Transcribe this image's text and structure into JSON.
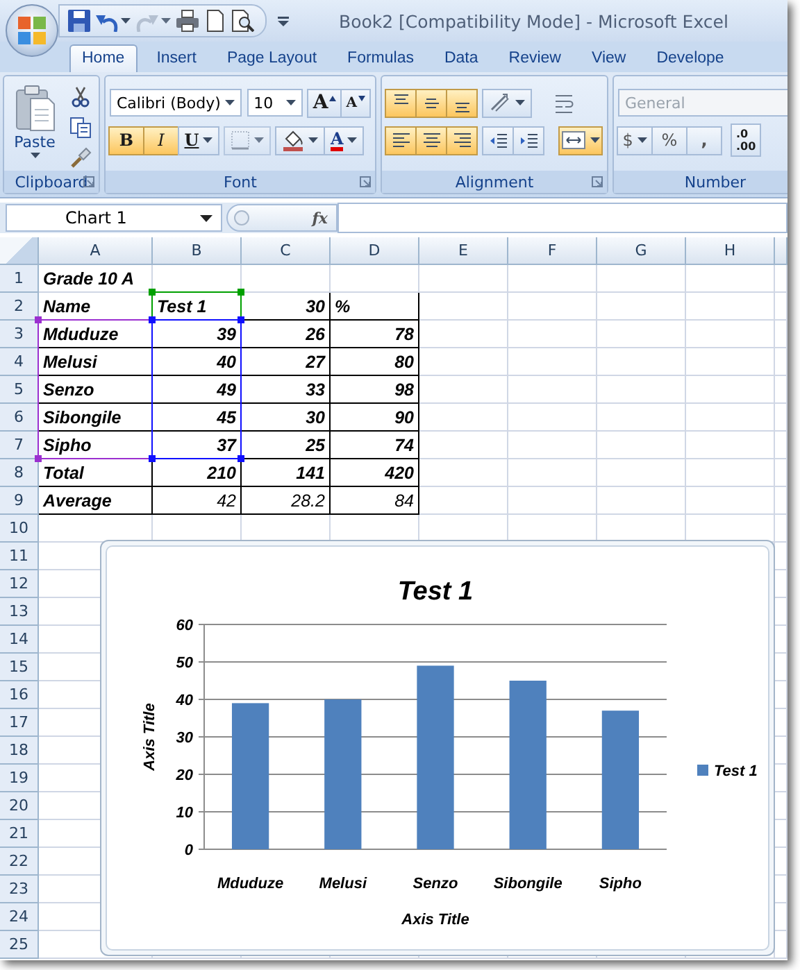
{
  "window": {
    "title": "Book2  [Compatibility Mode] - Microsoft Excel"
  },
  "tabs": [
    {
      "label": "Home",
      "selected": true
    },
    {
      "label": "Insert",
      "selected": false
    },
    {
      "label": "Page Layout",
      "selected": false
    },
    {
      "label": "Formulas",
      "selected": false
    },
    {
      "label": "Data",
      "selected": false
    },
    {
      "label": "Review",
      "selected": false
    },
    {
      "label": "View",
      "selected": false
    },
    {
      "label": "Develope",
      "selected": false
    }
  ],
  "ribbon": {
    "clipboard": {
      "label": "Clipboard",
      "paste": "Paste"
    },
    "font": {
      "label": "Font",
      "font_name": "Calibri (Body)",
      "font_size": "10",
      "grow": "A",
      "shrink": "A",
      "toggles": [
        {
          "label": "B",
          "on": true
        },
        {
          "label": "I",
          "on": true
        },
        {
          "label": "U",
          "on": false
        }
      ],
      "font_color": "A"
    },
    "alignment": {
      "label": "Alignment",
      "buttons": [
        {
          "kind": "top",
          "on": true
        },
        {
          "kind": "middle",
          "on": true
        },
        {
          "kind": "bottom",
          "on": true
        },
        {
          "kind": "left",
          "on": true
        },
        {
          "kind": "center",
          "on": true
        },
        {
          "kind": "right",
          "on": true
        }
      ],
      "merge_on": true
    },
    "number": {
      "label": "Number",
      "format": "General",
      "format_disabled": true,
      "currency": "$",
      "percent": "%",
      "comma": ",",
      "decimal_top": ".0",
      "decimal_bottom": ".00"
    }
  },
  "formula_bar": {
    "name_box": "Chart 1",
    "function_label": "fx"
  },
  "sheet": {
    "columns": [
      "A",
      "B",
      "C",
      "D",
      "E",
      "F",
      "G",
      "H"
    ],
    "rows": [
      {
        "number": "1",
        "outlined": false,
        "cells": [
          {
            "text": "Grade 10 A",
            "kind": "text"
          }
        ]
      },
      {
        "number": "2",
        "outlined": true,
        "cells": [
          {
            "text": "Name",
            "kind": "text"
          },
          {
            "text": "Test 1",
            "kind": "text",
            "color": "#00a000"
          },
          {
            "text": "30",
            "kind": "number"
          },
          {
            "text": "%",
            "kind": "text"
          }
        ]
      },
      {
        "number": "3",
        "outlined": true,
        "cells": [
          {
            "text": "Mduduze",
            "kind": "text",
            "color": "#9b30d0"
          },
          {
            "text": "39",
            "kind": "number",
            "color": "#1010ff"
          },
          {
            "text": "26",
            "kind": "number"
          },
          {
            "text": "78",
            "kind": "number"
          }
        ]
      },
      {
        "number": "4",
        "outlined": true,
        "cells": [
          {
            "text": "Melusi",
            "kind": "text",
            "color": "#9b30d0"
          },
          {
            "text": "40",
            "kind": "number",
            "color": "#1010ff"
          },
          {
            "text": "27",
            "kind": "number"
          },
          {
            "text": "80",
            "kind": "number"
          }
        ]
      },
      {
        "number": "5",
        "outlined": true,
        "cells": [
          {
            "text": "Senzo",
            "kind": "text",
            "color": "#9b30d0"
          },
          {
            "text": "49",
            "kind": "number",
            "color": "#1010ff"
          },
          {
            "text": "33",
            "kind": "number"
          },
          {
            "text": "98",
            "kind": "number"
          }
        ]
      },
      {
        "number": "6",
        "outlined": true,
        "cells": [
          {
            "text": "Sibongile",
            "kind": "text",
            "color": "#9b30d0"
          },
          {
            "text": "45",
            "kind": "number",
            "color": "#1010ff"
          },
          {
            "text": "30",
            "kind": "number"
          },
          {
            "text": "90",
            "kind": "number"
          }
        ]
      },
      {
        "number": "7",
        "outlined": true,
        "cells": [
          {
            "text": "Sipho",
            "kind": "text",
            "color": "#9b30d0"
          },
          {
            "text": "37",
            "kind": "number",
            "color": "#1010ff"
          },
          {
            "text": "25",
            "kind": "number"
          },
          {
            "text": "74",
            "kind": "number"
          }
        ]
      },
      {
        "number": "8",
        "outlined": true,
        "cells": [
          {
            "text": "Total",
            "kind": "text"
          },
          {
            "text": "210",
            "kind": "number"
          },
          {
            "text": "141",
            "kind": "number"
          },
          {
            "text": "420",
            "kind": "number"
          }
        ]
      },
      {
        "number": "9",
        "outlined": true,
        "cells": [
          {
            "text": "Average",
            "kind": "text"
          },
          {
            "text": "42",
            "kind": "value"
          },
          {
            "text": "28.2",
            "kind": "value"
          },
          {
            "text": "84",
            "kind": "value"
          }
        ]
      },
      {
        "number": "10",
        "outlined": false,
        "cells": []
      },
      {
        "number": "11",
        "cells": []
      },
      {
        "number": "12",
        "cells": []
      },
      {
        "number": "13",
        "cells": []
      },
      {
        "number": "14",
        "cells": []
      },
      {
        "number": "15",
        "cells": []
      },
      {
        "number": "16",
        "cells": []
      },
      {
        "number": "17",
        "cells": []
      },
      {
        "number": "18",
        "cells": []
      },
      {
        "number": "19",
        "cells": []
      },
      {
        "number": "20",
        "cells": []
      },
      {
        "number": "21",
        "cells": []
      },
      {
        "number": "22",
        "cells": []
      },
      {
        "number": "23",
        "cells": []
      },
      {
        "number": "24",
        "cells": []
      },
      {
        "number": "25",
        "cells": []
      }
    ]
  },
  "chart": {
    "chart_data": {
      "type": "bar",
      "grid": true,
      "title": "Test 1",
      "xlabel": "Axis Title",
      "ylabel": "Axis Title",
      "categories": [
        "Mduduze",
        "Melusi",
        "Senzo",
        "Sibongile",
        "Sipho"
      ],
      "series": [
        {
          "name": "Test 1",
          "color": "#4f81bd",
          "values": [
            39,
            40,
            49,
            45,
            37
          ]
        }
      ],
      "ylim": [
        0,
        60
      ],
      "yticks": [
        0,
        10,
        20,
        30,
        40,
        50,
        60
      ]
    }
  }
}
